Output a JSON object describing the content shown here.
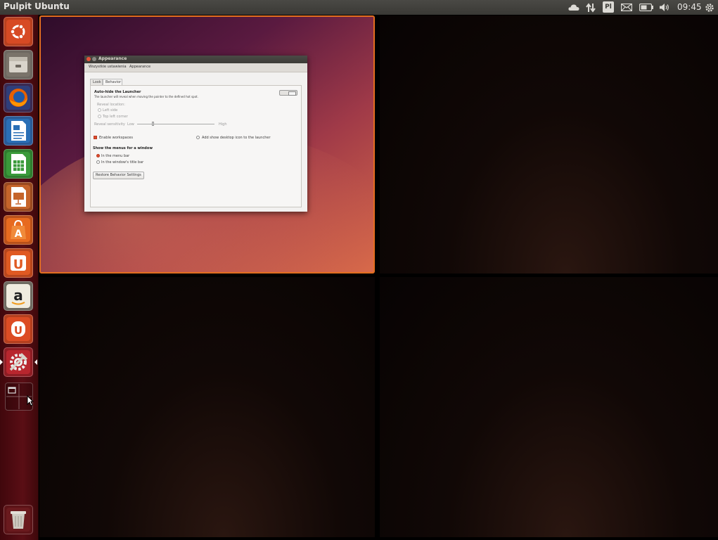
{
  "panel": {
    "title": "Pulpit Ubuntu",
    "clock": "09:45",
    "indicators": [
      "cloud-icon",
      "network-transfer-icon",
      "keyboard-layout-icon",
      "mail-icon",
      "battery-icon",
      "volume-icon",
      "settings-gear-icon"
    ],
    "keyboard_layout": "Pl"
  },
  "launcher": {
    "items": [
      {
        "name": "dash-home",
        "icon": "ubuntu-logo-icon",
        "color": "#d74a24"
      },
      {
        "name": "files",
        "icon": "file-cabinet-icon",
        "color": "#8c8579"
      },
      {
        "name": "firefox",
        "icon": "firefox-icon",
        "color": "#e66000"
      },
      {
        "name": "libreoffice-writer",
        "icon": "writer-document-icon",
        "color": "#2a6fb6"
      },
      {
        "name": "libreoffice-calc",
        "icon": "calc-spreadsheet-icon",
        "color": "#3a9a3a"
      },
      {
        "name": "libreoffice-impress",
        "icon": "impress-presentation-icon",
        "color": "#c5642a"
      },
      {
        "name": "software-center",
        "icon": "software-center-bag-icon",
        "color": "#e76a1f"
      },
      {
        "name": "ubuntu-one",
        "icon": "ubuntu-one-icon",
        "color": "#e05a22"
      },
      {
        "name": "amazon",
        "icon": "amazon-icon",
        "color": "#f0ecdf"
      },
      {
        "name": "ubuntu-one-music",
        "icon": "ubuntu-one-music-icon",
        "color": "#dc4c24"
      },
      {
        "name": "system-settings",
        "icon": "system-settings-icon",
        "color": "#b8262e"
      }
    ],
    "letters": {
      "amazon": "a",
      "ubuntu_one": "U",
      "software_center": "A"
    },
    "active_item": "system-settings",
    "trash": "trash-icon"
  },
  "appearance_window": {
    "title": "Appearance",
    "breadcrumb": [
      "Wszystkie ustawienia",
      "Appearance"
    ],
    "tabs": [
      "Look",
      "Behavior"
    ],
    "active_tab": "Behavior",
    "autohide": {
      "heading": "Auto-hide the Launcher",
      "description": "The launcher will reveal when moving the pointer to the defined hot spot.",
      "reveal_location_label": "Reveal location:",
      "options": [
        "Left side",
        "Top left corner"
      ],
      "selected_option": "Left side",
      "sensitivity_label": "Reveal sensitivity",
      "low_label": "Low",
      "high_label": "High",
      "sensitivity_value": 0.2,
      "enabled": false
    },
    "enable_workspaces": {
      "label": "Enable workspaces",
      "checked": true
    },
    "show_desktop_icon": {
      "label": "Add show desktop icon to the launcher",
      "checked": false
    },
    "menus": {
      "heading": "Show the menus for a window",
      "options": [
        "In the menu bar",
        "In the window's title bar"
      ],
      "selected": "In the menu bar"
    },
    "restore_button": "Restore Behavior Settings"
  }
}
